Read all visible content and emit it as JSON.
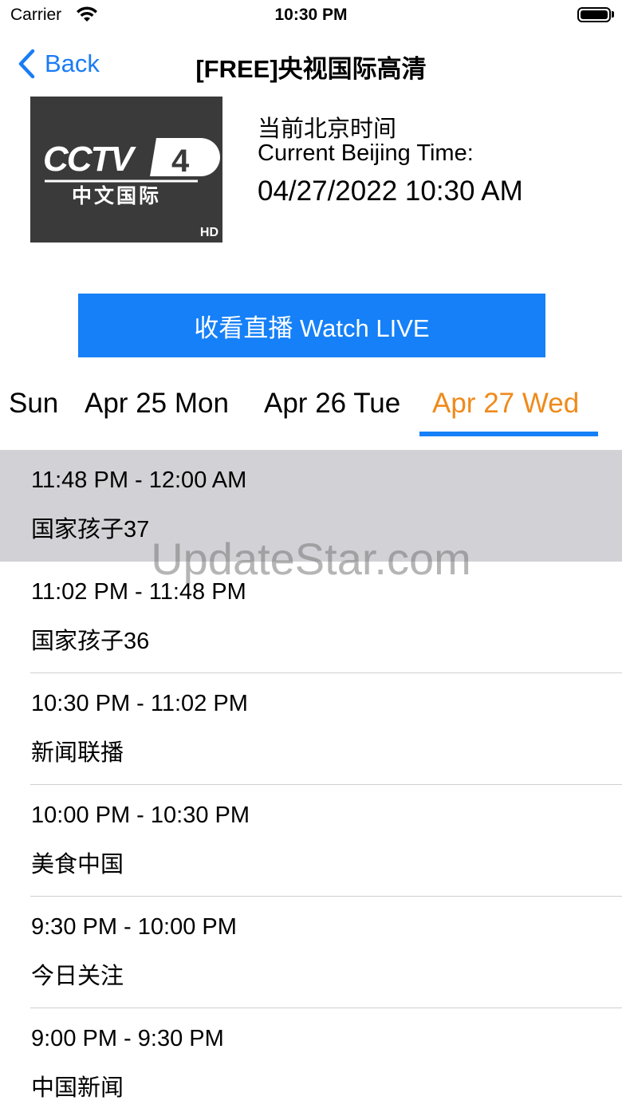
{
  "status_bar": {
    "carrier": "Carrier",
    "time": "10:30 PM"
  },
  "nav": {
    "back_label": "Back",
    "title": "[FREE]央视国际高清"
  },
  "channel": {
    "logo_text": "CCTV 4",
    "logo_subtitle": "中文国际",
    "logo_badge": "HD",
    "time_label_zh": "当前北京时间",
    "time_label_en": "Current Beijing Time:",
    "time_value": "04/27/2022 10:30 AM"
  },
  "watch_button": {
    "label": "收看直播 Watch LIVE"
  },
  "tabs": [
    {
      "label": "Sun",
      "active": false
    },
    {
      "label": "Apr 25 Mon",
      "active": false
    },
    {
      "label": "Apr 26 Tue",
      "active": false
    },
    {
      "label": "Apr 27 Wed",
      "active": true
    }
  ],
  "schedule": [
    {
      "time": "11:48 PM - 12:00 AM",
      "program": "国家孩子37",
      "selected": true
    },
    {
      "time": "11:02 PM - 11:48 PM",
      "program": "国家孩子36",
      "selected": false
    },
    {
      "time": "10:30 PM - 11:02 PM",
      "program": "新闻联播",
      "selected": false
    },
    {
      "time": "10:00 PM - 10:30 PM",
      "program": "美食中国",
      "selected": false
    },
    {
      "time": "9:30 PM - 10:00 PM",
      "program": "今日关注",
      "selected": false
    },
    {
      "time": "9:00 PM - 9:30 PM",
      "program": "中国新闻",
      "selected": false
    }
  ],
  "watermark": "UpdateStar.com",
  "colors": {
    "accent_blue": "#1580f7",
    "active_tab": "#ef8a1b",
    "selected_row": "#d1d1d6"
  }
}
